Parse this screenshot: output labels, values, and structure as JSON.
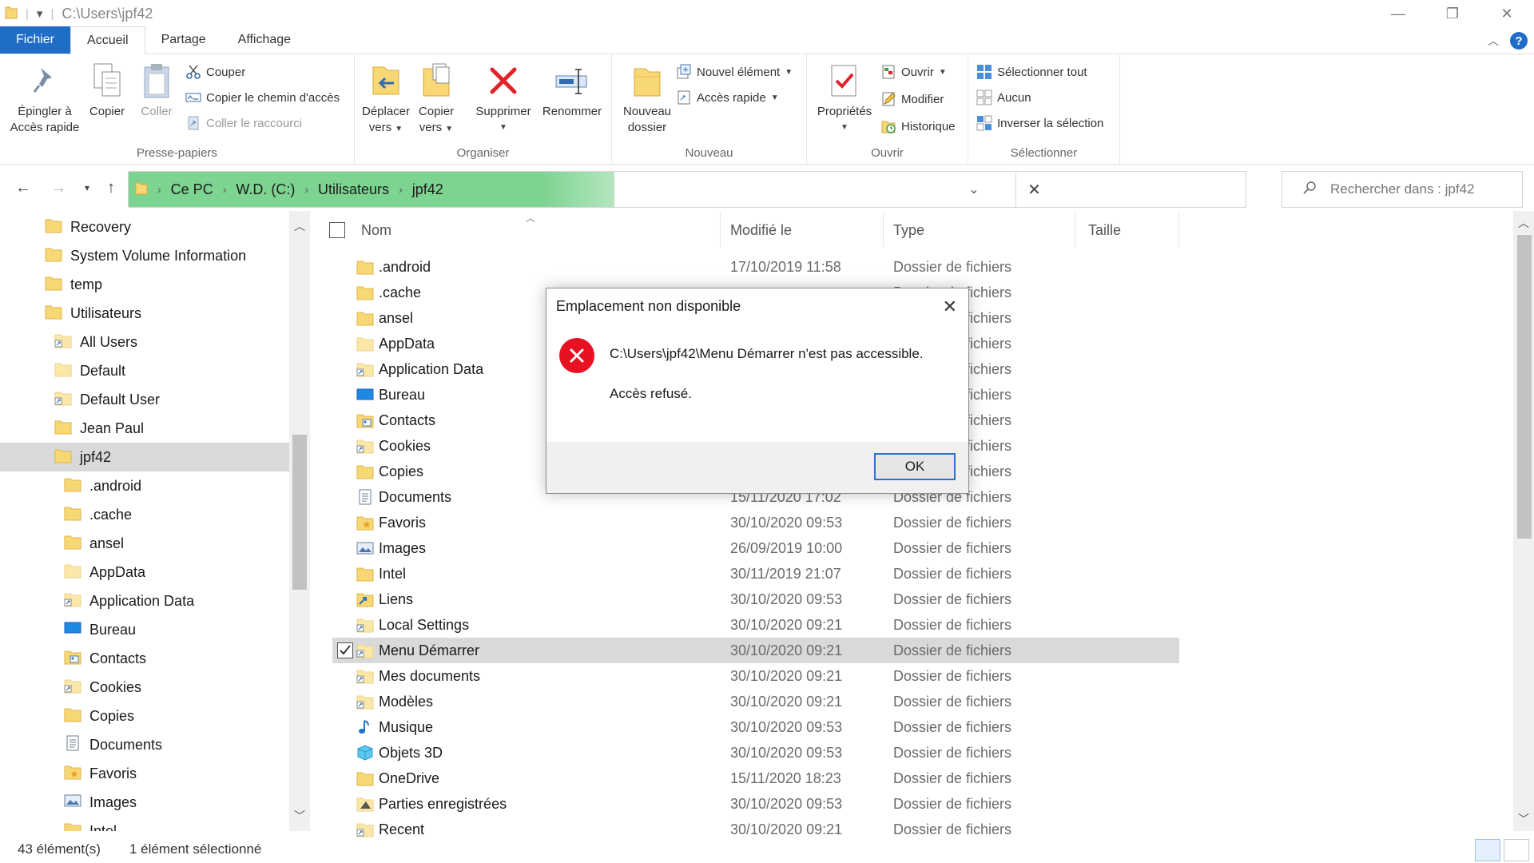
{
  "window": {
    "title_path": "C:\\Users\\jpf42",
    "min_glyph": "—",
    "max_glyph": "❐",
    "close_glyph": "✕"
  },
  "tabs": [
    "Fichier",
    "Accueil",
    "Partage",
    "Affichage"
  ],
  "ribbon": {
    "pin_l1": "Épingler à",
    "pin_l2": "Accès rapide",
    "copy": "Copier",
    "paste": "Coller",
    "cut": "Couper",
    "copy_path": "Copier le chemin d'accès",
    "paste_shortcut": "Coller le raccourci",
    "group_clipboard": "Presse-papiers",
    "move_l1": "Déplacer",
    "move_l2": "vers",
    "copyto_l1": "Copier",
    "copyto_l2": "vers",
    "delete": "Supprimer",
    "rename": "Renommer",
    "group_organize": "Organiser",
    "new_folder_l1": "Nouveau",
    "new_folder_l2": "dossier",
    "new_item": "Nouvel élément",
    "quick_access": "Accès rapide",
    "group_new": "Nouveau",
    "properties": "Propriétés",
    "open": "Ouvrir",
    "edit": "Modifier",
    "history": "Historique",
    "group_open": "Ouvrir",
    "select_all": "Sélectionner tout",
    "select_none": "Aucun",
    "invert": "Inverser la sélection",
    "group_select": "Sélectionner"
  },
  "address": {
    "crumbs": [
      "Ce PC",
      "W.D. (C:)",
      "Utilisateurs",
      "jpf42"
    ],
    "search_placeholder": "Rechercher dans : jpf42",
    "progress_color": "#7dd390"
  },
  "tree": [
    {
      "label": "Recovery",
      "indent": 0,
      "icon": "folder"
    },
    {
      "label": "System Volume Information",
      "indent": 0,
      "icon": "folder"
    },
    {
      "label": "temp",
      "indent": 0,
      "icon": "folder"
    },
    {
      "label": "Utilisateurs",
      "indent": 0,
      "icon": "folder"
    },
    {
      "label": "All Users",
      "indent": 1,
      "icon": "shortcut"
    },
    {
      "label": "Default",
      "indent": 1,
      "icon": "folder-light"
    },
    {
      "label": "Default User",
      "indent": 1,
      "icon": "shortcut"
    },
    {
      "label": "Jean Paul",
      "indent": 1,
      "icon": "folder"
    },
    {
      "label": "jpf42",
      "indent": 1,
      "icon": "folder",
      "selected": true
    },
    {
      "label": ".android",
      "indent": 2,
      "icon": "folder"
    },
    {
      "label": ".cache",
      "indent": 2,
      "icon": "folder"
    },
    {
      "label": "ansel",
      "indent": 2,
      "icon": "folder"
    },
    {
      "label": "AppData",
      "indent": 2,
      "icon": "folder-light"
    },
    {
      "label": "Application Data",
      "indent": 2,
      "icon": "shortcut"
    },
    {
      "label": "Bureau",
      "indent": 2,
      "icon": "desktop"
    },
    {
      "label": "Contacts",
      "indent": 2,
      "icon": "contacts"
    },
    {
      "label": "Cookies",
      "indent": 2,
      "icon": "shortcut"
    },
    {
      "label": "Copies",
      "indent": 2,
      "icon": "folder"
    },
    {
      "label": "Documents",
      "indent": 2,
      "icon": "documents"
    },
    {
      "label": "Favoris",
      "indent": 2,
      "icon": "favorites"
    },
    {
      "label": "Images",
      "indent": 2,
      "icon": "images"
    },
    {
      "label": "Intel",
      "indent": 2,
      "icon": "folder"
    }
  ],
  "columns": {
    "name": "Nom",
    "modified": "Modifié le",
    "type": "Type",
    "size": "Taille"
  },
  "files": [
    {
      "name": ".android",
      "date": "17/10/2019 11:58",
      "type": "Dossier de fichiers",
      "icon": "folder"
    },
    {
      "name": ".cache",
      "date": "",
      "type": "Dossier de fichiers",
      "icon": "folder"
    },
    {
      "name": "ansel",
      "date": "",
      "type": "Dossier de fichiers",
      "icon": "folder"
    },
    {
      "name": "AppData",
      "date": "",
      "type": "Dossier de fichiers",
      "icon": "folder-light"
    },
    {
      "name": "Application Data",
      "date": "",
      "type": "Dossier de fichiers",
      "icon": "shortcut"
    },
    {
      "name": "Bureau",
      "date": "",
      "type": "Dossier de fichiers",
      "icon": "desktop"
    },
    {
      "name": "Contacts",
      "date": "",
      "type": "Dossier de fichiers",
      "icon": "contacts"
    },
    {
      "name": "Cookies",
      "date": "",
      "type": "Dossier de fichiers",
      "icon": "shortcut"
    },
    {
      "name": "Copies",
      "date": "",
      "type": "Dossier de fichiers",
      "icon": "folder"
    },
    {
      "name": "Documents",
      "date": "15/11/2020 17:02",
      "type": "Dossier de fichiers",
      "icon": "documents"
    },
    {
      "name": "Favoris",
      "date": "30/10/2020 09:53",
      "type": "Dossier de fichiers",
      "icon": "favorites"
    },
    {
      "name": "Images",
      "date": "26/09/2019 10:00",
      "type": "Dossier de fichiers",
      "icon": "images"
    },
    {
      "name": "Intel",
      "date": "30/11/2019 21:07",
      "type": "Dossier de fichiers",
      "icon": "folder"
    },
    {
      "name": "Liens",
      "date": "30/10/2020 09:53",
      "type": "Dossier de fichiers",
      "icon": "links"
    },
    {
      "name": "Local Settings",
      "date": "30/10/2020 09:21",
      "type": "Dossier de fichiers",
      "icon": "shortcut"
    },
    {
      "name": "Menu Démarrer",
      "date": "30/10/2020 09:21",
      "type": "Dossier de fichiers",
      "icon": "shortcut",
      "selected": true
    },
    {
      "name": "Mes documents",
      "date": "30/10/2020 09:21",
      "type": "Dossier de fichiers",
      "icon": "shortcut"
    },
    {
      "name": "Modèles",
      "date": "30/10/2020 09:21",
      "type": "Dossier de fichiers",
      "icon": "shortcut"
    },
    {
      "name": "Musique",
      "date": "30/10/2020 09:53",
      "type": "Dossier de fichiers",
      "icon": "music"
    },
    {
      "name": "Objets 3D",
      "date": "30/10/2020 09:53",
      "type": "Dossier de fichiers",
      "icon": "objects3d"
    },
    {
      "name": "OneDrive",
      "date": "15/11/2020 18:23",
      "type": "Dossier de fichiers",
      "icon": "folder"
    },
    {
      "name": "Parties enregistrées",
      "date": "30/10/2020 09:53",
      "type": "Dossier de fichiers",
      "icon": "saved-games"
    },
    {
      "name": "Recent",
      "date": "30/10/2020 09:21",
      "type": "Dossier de fichiers",
      "icon": "shortcut"
    }
  ],
  "status": {
    "count": "43 élément(s)",
    "selection": "1 élément sélectionné"
  },
  "dialog": {
    "title": "Emplacement non disponible",
    "message": "C:\\Users\\jpf42\\Menu Démarrer n'est pas accessible.",
    "detail": "Accès refusé.",
    "ok": "OK",
    "error_color": "#e81123"
  },
  "colors": {
    "accent": "#1f6dc6",
    "folder": "#f8d775",
    "selection": "#d9d9d9"
  }
}
